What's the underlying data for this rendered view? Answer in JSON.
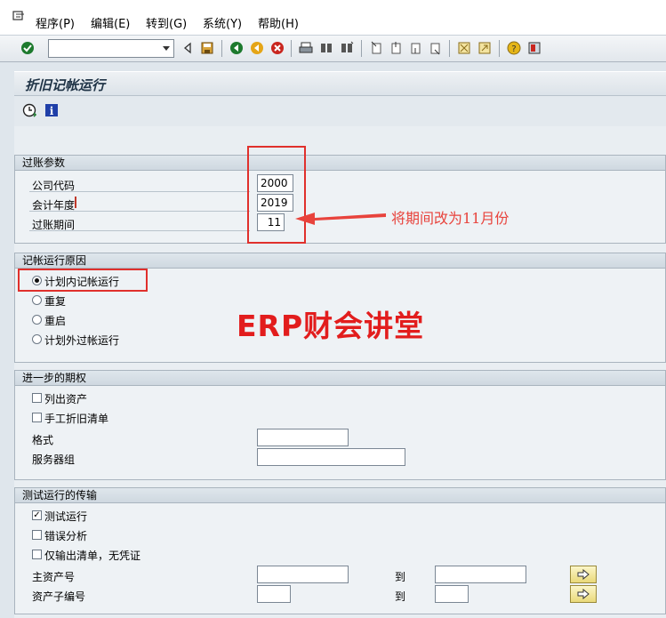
{
  "menu": {
    "items": [
      "程序(P)",
      "编辑(E)",
      "转到(G)",
      "系统(Y)",
      "帮助(H)"
    ]
  },
  "toolbar": {
    "command_field_value": ""
  },
  "screen": {
    "title": "折旧记帐运行"
  },
  "posting_params": {
    "title": "过账参数",
    "company_code_label": "公司代码",
    "company_code_value": "2000",
    "fiscal_year_label": "会计年度",
    "fiscal_year_value": "2019",
    "period_label": "过账期间",
    "period_value": "11"
  },
  "annotation": {
    "note": "将期间改为11月份",
    "watermark": "ERP财会讲堂"
  },
  "run_reason": {
    "title": "记帐运行原因",
    "options": [
      "计划内记帐运行",
      "重复",
      "重启",
      "计划外过帐运行"
    ],
    "selected_index": 0
  },
  "further_options": {
    "title": "进一步的期权",
    "list_assets_label": "列出资产",
    "list_assets_checked": false,
    "manual_dep_label": "手工折旧清单",
    "manual_dep_checked": false,
    "layout_label": "格式",
    "layout_value": "",
    "server_group_label": "服务器组",
    "server_group_value": ""
  },
  "test_run": {
    "title": "测试运行的传输",
    "test_run_label": "测试运行",
    "test_run_checked": true,
    "error_analysis_label": "错误分析",
    "error_analysis_checked": false,
    "output_only_label": "仅输出清单，无凭证",
    "output_only_checked": false,
    "main_asset_label": "主资产号",
    "main_asset_from": "",
    "main_asset_to_label": "到",
    "main_asset_to": "",
    "sub_asset_label": "资产子编号",
    "sub_asset_from": "",
    "sub_asset_to_label": "到",
    "sub_asset_to": ""
  }
}
